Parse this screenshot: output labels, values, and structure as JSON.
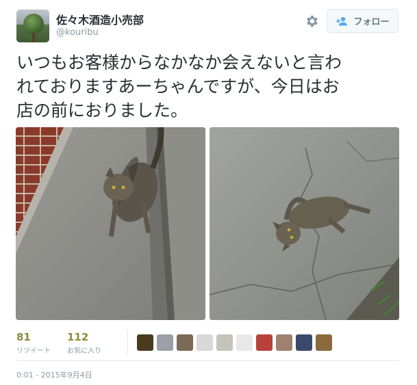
{
  "user": {
    "name": "佐々木酒造小売部",
    "handle": "@kouribu"
  },
  "header": {
    "follow_label": "フォロー",
    "gear_icon": "gear-icon",
    "follow_icon": "add-user-icon"
  },
  "tweet": {
    "line1": "いつもお客様からなかなか会えないと言わ",
    "line2": "れておりますあーちゃんですが、今日はお",
    "line3": "店の前におりました。"
  },
  "stats": {
    "retweets_count": "81",
    "retweets_label": "リツイート",
    "likes_count": "112",
    "likes_label": "お気に入り"
  },
  "liker_avatars": [
    {
      "color": "#4a3a1e"
    },
    {
      "color": "#9aa0a6"
    },
    {
      "color": "#7b6a55"
    },
    {
      "color": "#d8d8d8"
    },
    {
      "color": "#c4c4b8"
    },
    {
      "color": "#e8e8e8"
    },
    {
      "color": "#b8413a"
    },
    {
      "color": "#a08070"
    },
    {
      "color": "#3a4a6a"
    },
    {
      "color": "#8a6a3a"
    }
  ],
  "timestamp": "0:01 - 2015年9月4日",
  "colors": {
    "stat_number": "#8a8a3a",
    "muted": "#8899a6",
    "text": "#292f33"
  }
}
